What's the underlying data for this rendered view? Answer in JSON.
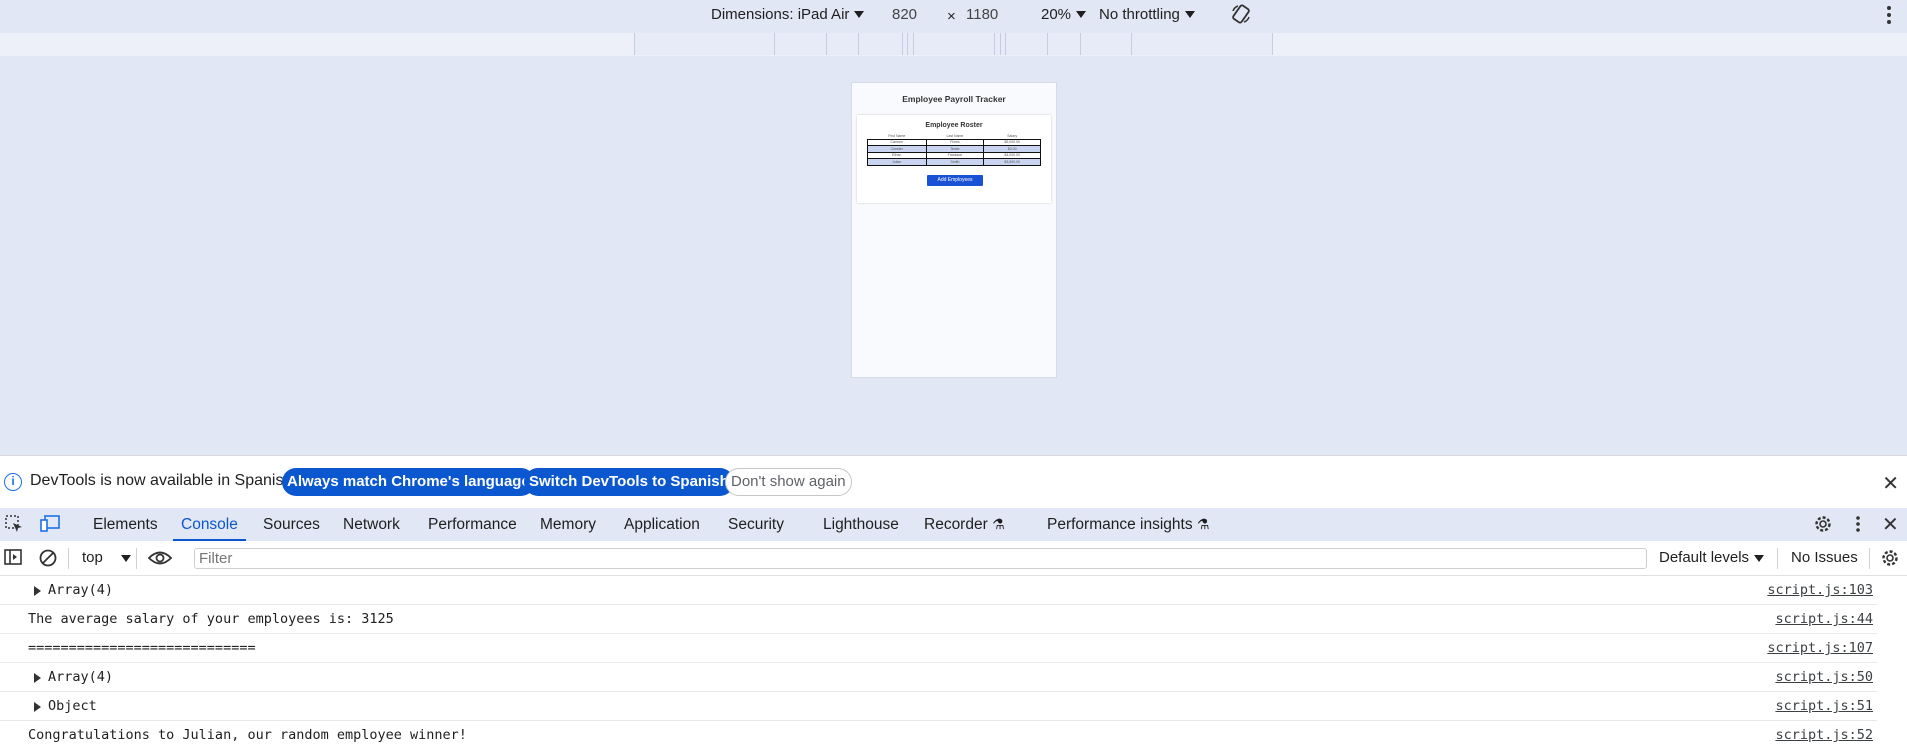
{
  "device_toolbar": {
    "dimensions_label": "Dimensions: iPad Air",
    "width": "820",
    "times": "×",
    "height": "1180",
    "zoom": "20%",
    "throttling": "No throttling"
  },
  "device_page": {
    "title": "Employee Payroll Tracker",
    "roster_title": "Employee Roster",
    "columns": [
      "First Name",
      "Last Name",
      "Salary"
    ],
    "rows": [
      [
        "Carmen",
        "Flores",
        "$5,000.00"
      ],
      [
        "Chester",
        "Tester",
        "$0.00"
      ],
      [
        "Ethan",
        "Frankson",
        "$4,000.00"
      ],
      [
        "Julian",
        "Smith",
        "$3,500.00"
      ]
    ],
    "add_button": "Add Employees"
  },
  "infobar": {
    "message": "DevTools is now available in Spanish!",
    "btn_match": "Always match Chrome's language",
    "btn_switch": "Switch DevTools to Spanish",
    "btn_dismiss": "Don't show again"
  },
  "tabs": [
    "Elements",
    "Console",
    "Sources",
    "Network",
    "Performance",
    "Memory",
    "Application",
    "Security",
    "Lighthouse",
    "Recorder",
    "Performance insights"
  ],
  "active_tab": "Console",
  "console_toolbar": {
    "context": "top",
    "filter_placeholder": "Filter",
    "levels": "Default levels",
    "issues": "No Issues"
  },
  "messages": [
    {
      "text": "Array(4)",
      "expandable": true,
      "source": "script.js:103"
    },
    {
      "text": "The average salary of your employees is: 3125",
      "expandable": false,
      "source": "script.js:44"
    },
    {
      "text": "============================",
      "expandable": false,
      "source": "script.js:107"
    },
    {
      "text": "Array(4)",
      "expandable": true,
      "source": "script.js:50"
    },
    {
      "text": "Object",
      "expandable": true,
      "source": "script.js:51"
    },
    {
      "text": "Congratulations to Julian, our random employee winner!",
      "expandable": false,
      "source": "script.js:52"
    }
  ]
}
